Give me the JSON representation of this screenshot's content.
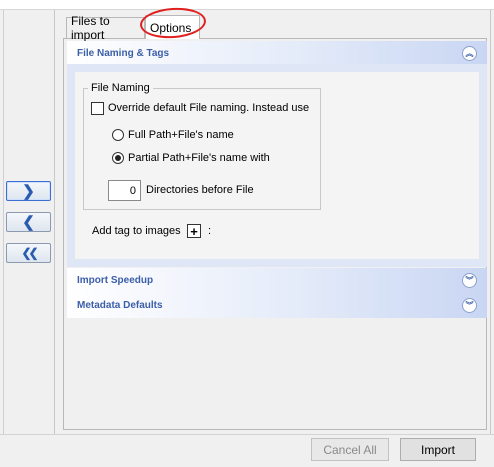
{
  "tabs": [
    {
      "label": "Files to import"
    },
    {
      "label": "Options"
    }
  ],
  "sections": {
    "file_naming": {
      "title": "File Naming & Tags",
      "state": "expanded"
    },
    "import_speedup": {
      "title": "Import Speedup",
      "state": "collapsed"
    },
    "metadata_defaults": {
      "title": "Metadata Defaults",
      "state": "collapsed"
    }
  },
  "file_naming": {
    "group_title": "File Naming",
    "override_label": "Override default File naming. Instead use",
    "override_checked": false,
    "full_path_label": "Full Path+File's name",
    "partial_path_label": "Partial Path+File's name with",
    "selected_option": "partial",
    "directories_value": "0",
    "directories_label": "Directories before File"
  },
  "add_tag": {
    "label": "Add tag to images",
    "suffix": ":"
  },
  "arrows": [
    {
      "icon": "chevron-right-icon",
      "glyph": "❯"
    },
    {
      "icon": "chevron-left-icon",
      "glyph": "❮"
    },
    {
      "icon": "double-chevron-left-icon",
      "glyph": "❮❮"
    }
  ],
  "buttons": {
    "cancel_all": "Cancel All",
    "import": "Import"
  },
  "colors": {
    "section_title": "#3a5ea8",
    "annotation_ring": "#e02020",
    "arrow": "#2a5db0"
  }
}
